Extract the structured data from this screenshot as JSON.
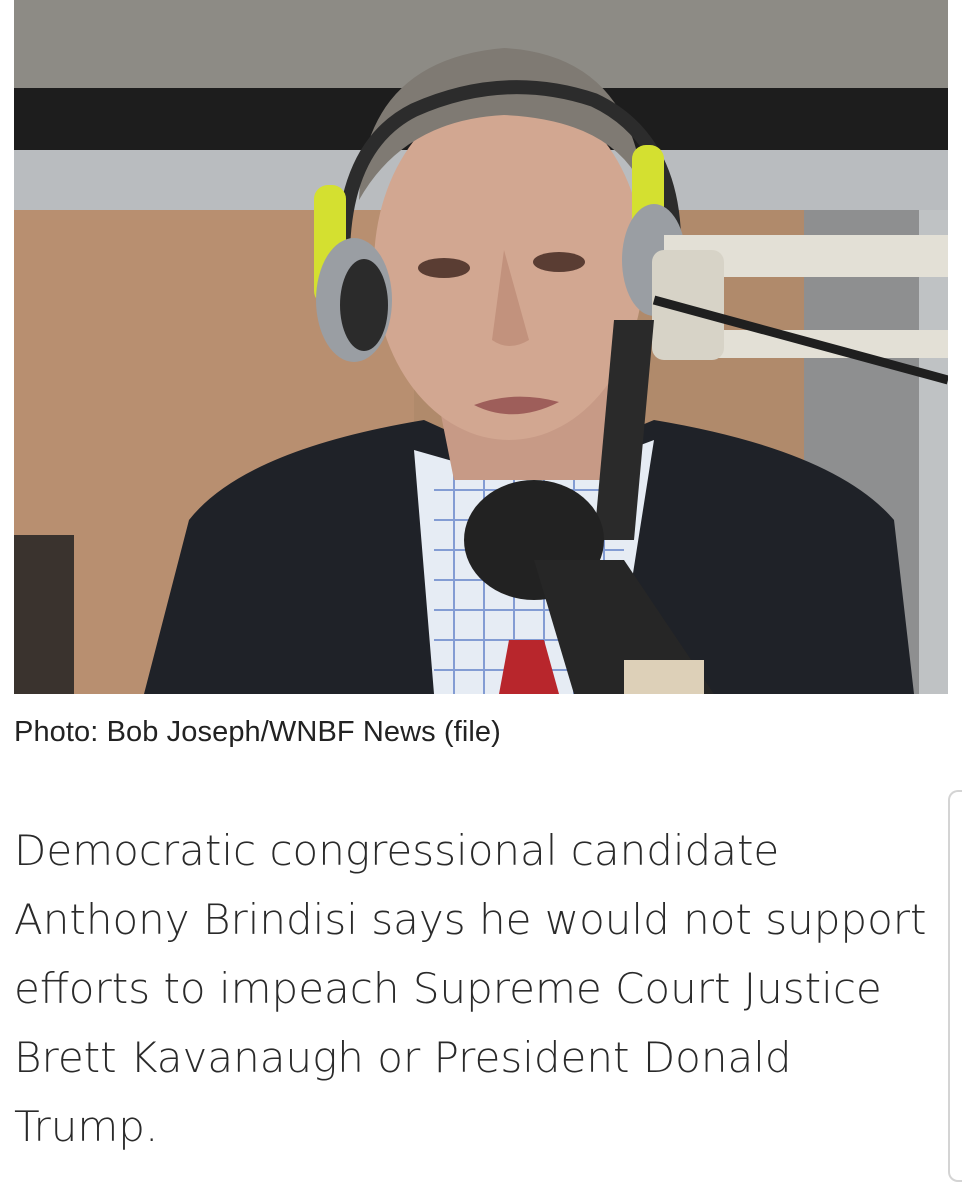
{
  "photo": {
    "alt": "Man wearing yellow headphones speaking into a studio microphone"
  },
  "caption": {
    "text": "Photo: Bob Joseph/WNBF News (file)"
  },
  "article": {
    "paragraph": "Democratic congressional candidate Anthony Brindisi says he would not support efforts to impeach Supreme Court Justice Brett Kavanaugh or President Donald Trump."
  },
  "colors": {
    "text": "#2a2a2a",
    "background": "#ffffff",
    "headphone_accent": "#d4e030"
  }
}
